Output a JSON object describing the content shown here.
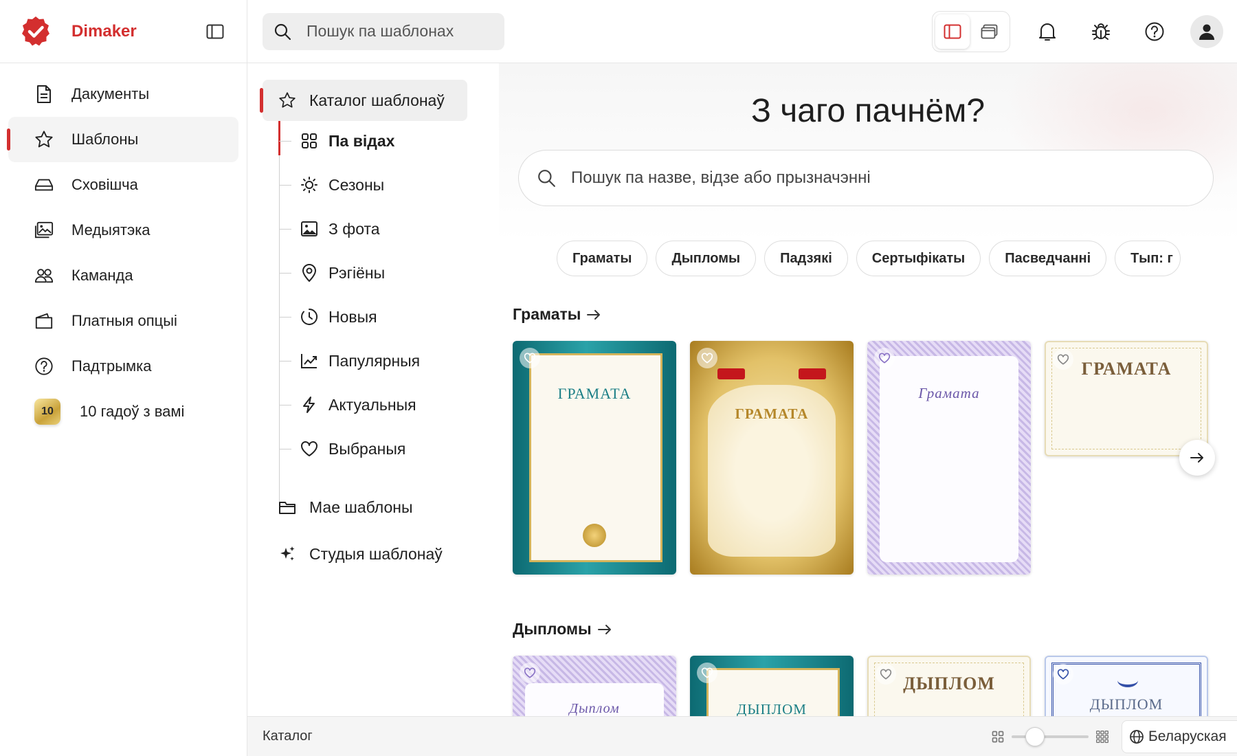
{
  "app": {
    "name": "Dimaker",
    "brand_color": "#d32f2f"
  },
  "sidebar": {
    "items": [
      {
        "label": "Дакументы",
        "icon": "document-icon",
        "active": false
      },
      {
        "label": "Шаблоны",
        "icon": "star-icon",
        "active": true
      },
      {
        "label": "Сховішча",
        "icon": "storage-icon",
        "active": false
      },
      {
        "label": "Медыятэка",
        "icon": "image-gallery-icon",
        "active": false
      },
      {
        "label": "Каманда",
        "icon": "team-icon",
        "active": false
      },
      {
        "label": "Платныя опцыі",
        "icon": "wallet-icon",
        "active": false
      },
      {
        "label": "Падтрымка",
        "icon": "help-icon",
        "active": false
      }
    ],
    "anniversary": {
      "badge": "10",
      "label": "10 гадоў з вамі"
    }
  },
  "topbar": {
    "search_placeholder": "Пошук па шаблонах",
    "icons": [
      "panel-view-icon",
      "window-view-icon",
      "bell-icon",
      "bug-icon",
      "help-icon",
      "user-icon"
    ]
  },
  "catalog": {
    "root_label": "Каталог шаблонаў",
    "children": [
      {
        "label": "Па відах",
        "icon": "grid-icon",
        "selected": true
      },
      {
        "label": "Сезоны",
        "icon": "sun-icon"
      },
      {
        "label": "З фота",
        "icon": "photo-icon"
      },
      {
        "label": "Рэгіёны",
        "icon": "location-pin-icon"
      },
      {
        "label": "Новыя",
        "icon": "clock-icon"
      },
      {
        "label": "Папулярныя",
        "icon": "trend-chart-icon"
      },
      {
        "label": "Актуальныя",
        "icon": "lightning-icon"
      },
      {
        "label": "Выбраныя",
        "icon": "heart-icon"
      }
    ],
    "my_templates": "Мае шаблоны",
    "studio": "Студыя шаблонаў"
  },
  "main": {
    "hero_title": "З чаго пачнём?",
    "search_placeholder": "Пошук па назве, відзе або прызначэнні",
    "chips": [
      "Граматы",
      "Дыпломы",
      "Падзякі",
      "Сертыфікаты",
      "Пасведчанні",
      "Тып: г"
    ],
    "sections": [
      {
        "title": "Граматы",
        "cards": [
          {
            "style": "teal",
            "title": "ГРАМАТА"
          },
          {
            "style": "gold",
            "title": "ГРАМАТА"
          },
          {
            "style": "violet",
            "title": "Грамата"
          },
          {
            "style": "cream",
            "title": "ГРАМАТА"
          }
        ]
      },
      {
        "title": "Дыпломы",
        "cards": [
          {
            "style": "violet",
            "title": "Дыплом"
          },
          {
            "style": "teal",
            "title": "ДЫПЛОМ"
          },
          {
            "style": "cream",
            "title": "ДЫПЛОМ"
          },
          {
            "style": "blue",
            "title": "ДЫПЛОМ"
          }
        ]
      }
    ]
  },
  "statusbar": {
    "text": "Каталог",
    "zoom_level": 0.3,
    "language": "Беларуская"
  }
}
